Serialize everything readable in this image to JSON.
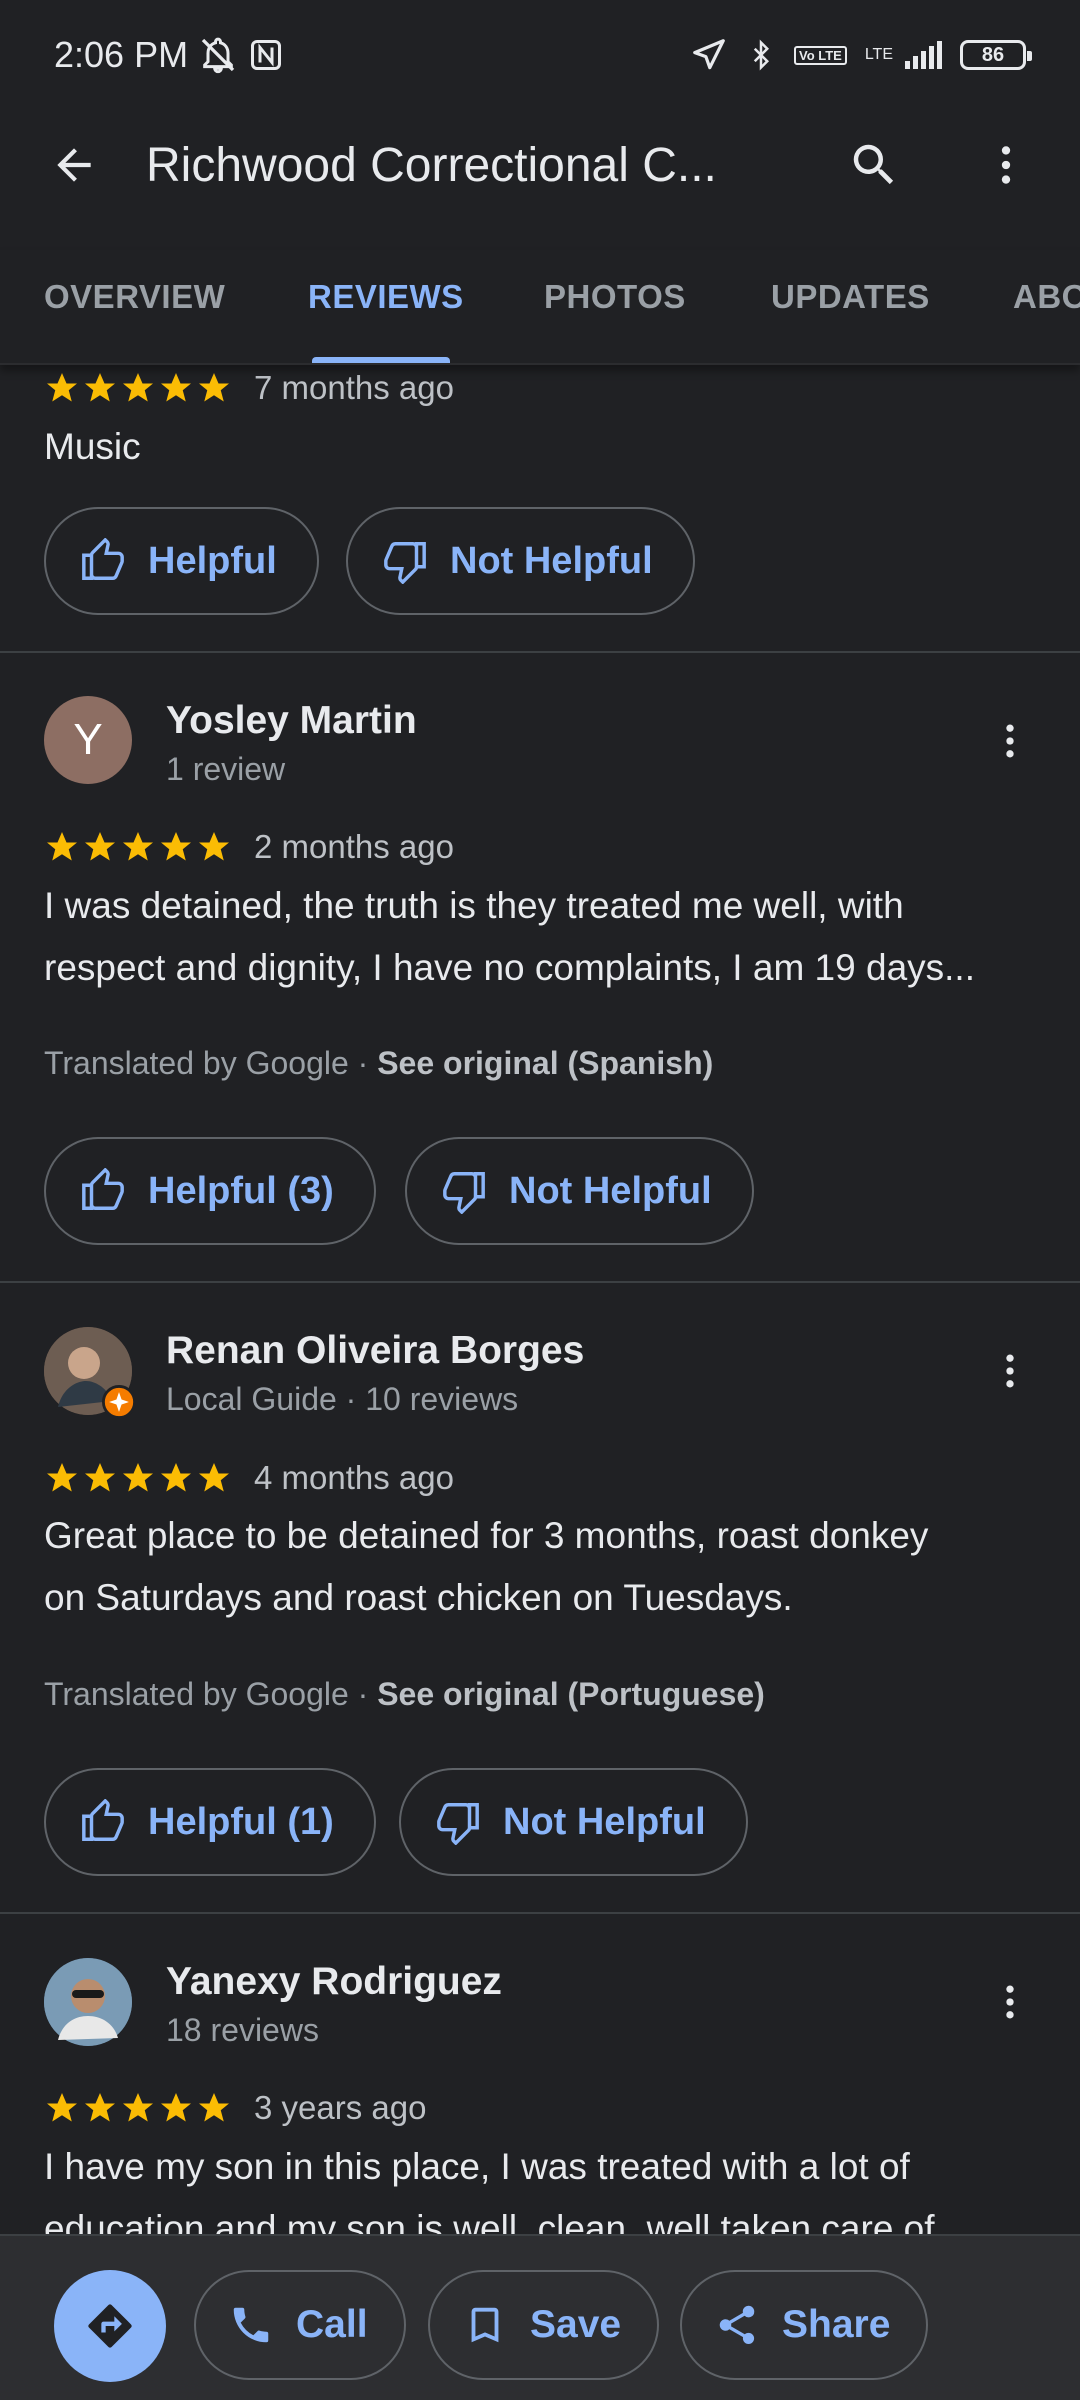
{
  "status_bar": {
    "time": "2:06 PM",
    "network": "LTE",
    "volte": "Vo LTE",
    "battery": "86",
    "icons": [
      "mute-icon",
      "nfc-icon",
      "location-icon",
      "bluetooth-icon",
      "signal-icon"
    ]
  },
  "app_bar": {
    "title": "Richwood Correctional C...",
    "icons": [
      "back-arrow-icon",
      "search-icon",
      "more-vert-icon"
    ]
  },
  "tabs": [
    {
      "label": "OVERVIEW",
      "active": false
    },
    {
      "label": "REVIEWS",
      "active": true
    },
    {
      "label": "PHOTOS",
      "active": false
    },
    {
      "label": "UPDATES",
      "active": false
    },
    {
      "label": "ABO",
      "active": false
    }
  ],
  "reviews": [
    {
      "rating": 5,
      "time": "7 months ago",
      "text": "Music",
      "helpful": "Helpful",
      "not_helpful": "Not Helpful"
    },
    {
      "author": "Yosley Martin",
      "avatar_letter": "Y",
      "avatar_color": "#8d6e63",
      "subtitle": "1 review",
      "rating": 5,
      "time": "2 months ago",
      "text_line1": "I was detained, the truth is they treated me well, with",
      "text_line2": "respect and dignity, I have no complaints, I am 19 days...",
      "translated_prefix": "Translated by Google · ",
      "see_original": "See original (Spanish)",
      "helpful": "Helpful (3)",
      "not_helpful": "Not Helpful"
    },
    {
      "author": "Renan Oliveira Borges",
      "subtitle": "Local Guide · 10 reviews",
      "rating": 5,
      "time": "4 months ago",
      "text_line1": "Great place to be detained for 3 months, roast donkey",
      "text_line2": "on Saturdays and roast chicken on Tuesdays.",
      "translated_prefix": "Translated by Google · ",
      "see_original": "See original (Portuguese)",
      "helpful": "Helpful (1)",
      "not_helpful": "Not Helpful"
    },
    {
      "author": "Yanexy Rodriguez",
      "subtitle": "18 reviews",
      "rating": 5,
      "time": "3 years ago",
      "text_line1": "I have my son in this place, I was treated with a lot of",
      "text_line2": "education and my son is well, clean, well taken care of"
    }
  ],
  "bottom_bar": {
    "call": "Call",
    "save": "Save",
    "share": "Share"
  },
  "colors": {
    "background": "#202124",
    "accent": "#8ab4f8",
    "star": "#fbbc04",
    "local_guide_badge": "#f57c00"
  }
}
